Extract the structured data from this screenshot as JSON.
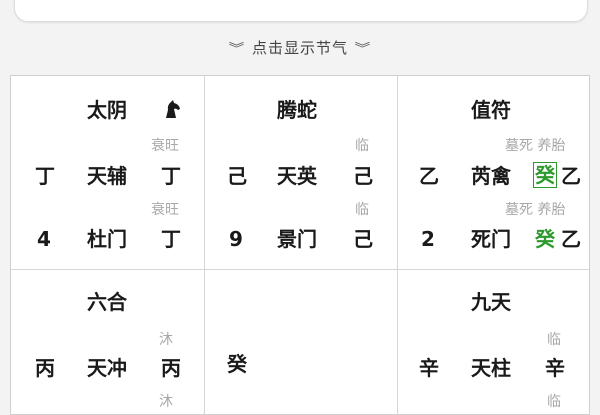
{
  "toggle": {
    "label": "点击显示节气",
    "icon_left": "double-chevron-down-icon",
    "icon_right": "double-chevron-down-icon"
  },
  "palaces": [
    {
      "deity": "太阴",
      "icon": "horse-head-icon",
      "row1": {
        "stem": "丁",
        "star": "天辅",
        "state": "衰旺",
        "heaven_stem": "丁"
      },
      "row2": {
        "number": "4",
        "door": "杜门",
        "state": "衰旺",
        "earth_stem": "丁"
      }
    },
    {
      "deity": "腾蛇",
      "row1": {
        "stem": "己",
        "star": "天英",
        "state": "临",
        "heaven_stem": "己"
      },
      "row2": {
        "number": "9",
        "door": "景门",
        "state": "临",
        "earth_stem": "己"
      }
    },
    {
      "deity": "值符",
      "row1": {
        "stem": "乙",
        "star": "芮禽",
        "state": "墓死 养胎",
        "heaven_stem_a": "癸",
        "heaven_stem_b": "乙"
      },
      "row2": {
        "number": "2",
        "door": "死门",
        "state": "墓死 养胎",
        "earth_stem_a": "癸",
        "earth_stem_b": "乙"
      }
    },
    {
      "deity": "六合",
      "row1": {
        "stem": "丙",
        "star": "天冲",
        "state": "沐",
        "heaven_stem": "丙"
      },
      "row2": {
        "state": "沐"
      }
    },
    {
      "center_stem": "癸"
    },
    {
      "deity": "九天",
      "row1": {
        "stem": "辛",
        "star": "天柱",
        "state": "临",
        "heaven_stem": "辛"
      },
      "row2": {
        "state": "临"
      }
    }
  ],
  "colors": {
    "accent_green": "#2e9a2e",
    "muted": "#a8a8a8"
  }
}
